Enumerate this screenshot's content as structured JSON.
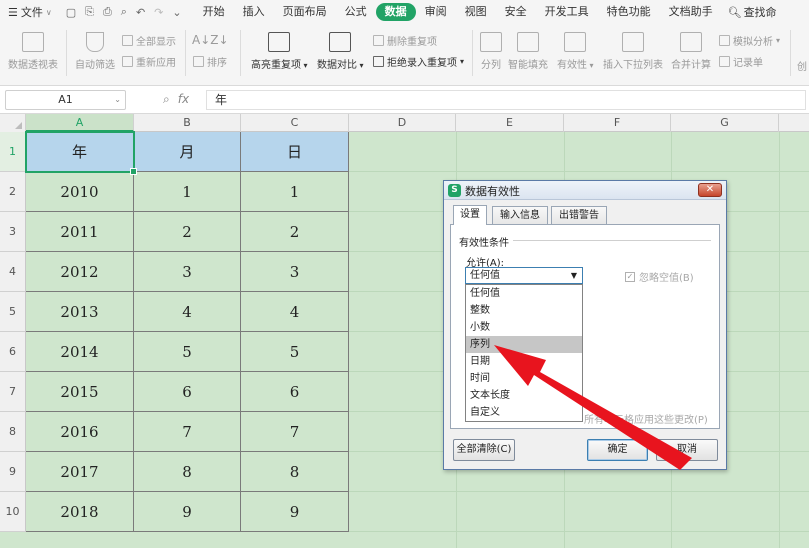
{
  "menubar": {
    "file_label": "文件",
    "tabs": [
      "开始",
      "插入",
      "页面布局",
      "公式",
      "数据",
      "审阅",
      "视图",
      "安全",
      "开发工具",
      "特色功能",
      "文档助手"
    ],
    "active_tab": "数据",
    "search_label": "查找命",
    "active_color": "#21a366"
  },
  "ribbon": {
    "pivot": "数据透视表",
    "autofilter": "自动筛选",
    "show_all": "全部显示",
    "reapply": "重新应用",
    "sort": "排序",
    "highlight_dup": "高亮重复项",
    "compare": "数据对比",
    "remove_dup": "删除重复项",
    "reject_dup": "拒绝录入重复项",
    "split": "分列",
    "smart_fill": "智能填充",
    "validity": "有效性",
    "insert_dropdown": "插入下拉列表",
    "consolidate": "合并计算",
    "simulate": "模拟分析",
    "record": "记录单",
    "more": "创"
  },
  "formulabar": {
    "namebox": "A1",
    "fx": "fx",
    "content": "年"
  },
  "sheet": {
    "columns": [
      "A",
      "B",
      "C",
      "D",
      "E",
      "F",
      "G"
    ],
    "rows": [
      "1",
      "2",
      "3",
      "4",
      "5",
      "6",
      "7",
      "8",
      "9",
      "10"
    ],
    "header_row": [
      "年",
      "月",
      "日"
    ],
    "data": [
      [
        "2010",
        "1",
        "1"
      ],
      [
        "2011",
        "2",
        "2"
      ],
      [
        "2012",
        "3",
        "3"
      ],
      [
        "2013",
        "4",
        "4"
      ],
      [
        "2014",
        "5",
        "5"
      ],
      [
        "2015",
        "6",
        "6"
      ],
      [
        "2016",
        "7",
        "7"
      ],
      [
        "2017",
        "8",
        "8"
      ],
      [
        "2018",
        "9",
        "9"
      ]
    ],
    "header_fill": "#b6d5ec",
    "sheet_fill": "#cfe6cd"
  },
  "dialog": {
    "title": "数据有效性",
    "close": "✕",
    "tabs": [
      "设置",
      "输入信息",
      "出错警告"
    ],
    "active_tab": "设置",
    "condition_label": "有效性条件",
    "allow_label": "允许(A):",
    "allow_value": "任何值",
    "options": [
      "任何值",
      "整数",
      "小数",
      "序列",
      "日期",
      "时间",
      "文本长度",
      "自定义"
    ],
    "highlighted_option": "序列",
    "ignore_blank": "忽略空值(B)",
    "apply_all": "所有单元格应用这些更改(P)",
    "clear_all": "全部清除(C)",
    "ok": "确定",
    "cancel": "取消"
  },
  "annotation": {
    "arrow_color": "#e8141e"
  }
}
